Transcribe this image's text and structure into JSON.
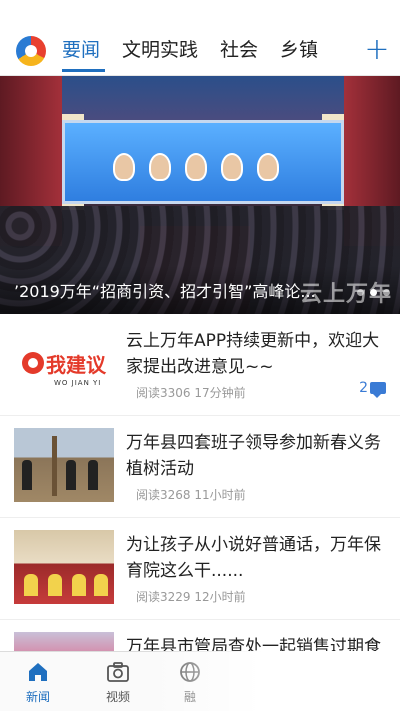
{
  "channels": {
    "tabs": [
      "要闻",
      "文明实践",
      "社会",
      "乡镇"
    ],
    "active": "要闻",
    "add_label": "+"
  },
  "banner": {
    "caption": "’2019万年“招商引资、招才引智”高峰论...",
    "watermark": "云上万年",
    "slides_total": 3,
    "slide_active": 2
  },
  "news": [
    {
      "title": "云上万年APP持续更新中，欢迎大家提出改进意见~~",
      "reads": "阅读3306",
      "time": "17分钟前",
      "comments": "2",
      "thumb_text": "我建议",
      "thumb_sub": "WO JIAN YI"
    },
    {
      "title": "万年县四套班子领导参加新春义务植树活动",
      "reads": "阅读3268",
      "time": "11小时前"
    },
    {
      "title": "为让孩子从小说好普通话，万年保育院这么干......",
      "reads": "阅读3229",
      "time": "12小时前"
    },
    {
      "title": "万年县市管局查处一起销售过期食品案"
    }
  ],
  "bottom_nav": [
    {
      "label": "新闻",
      "icon": "home-icon",
      "active": true
    },
    {
      "label": "视频",
      "icon": "camera-icon",
      "active": false
    },
    {
      "label": "融",
      "icon": "globe-icon",
      "active": false
    }
  ],
  "colors": {
    "accent": "#1f6fbf",
    "comment": "#3a7bd5",
    "logo_red": "#e43a2a"
  }
}
